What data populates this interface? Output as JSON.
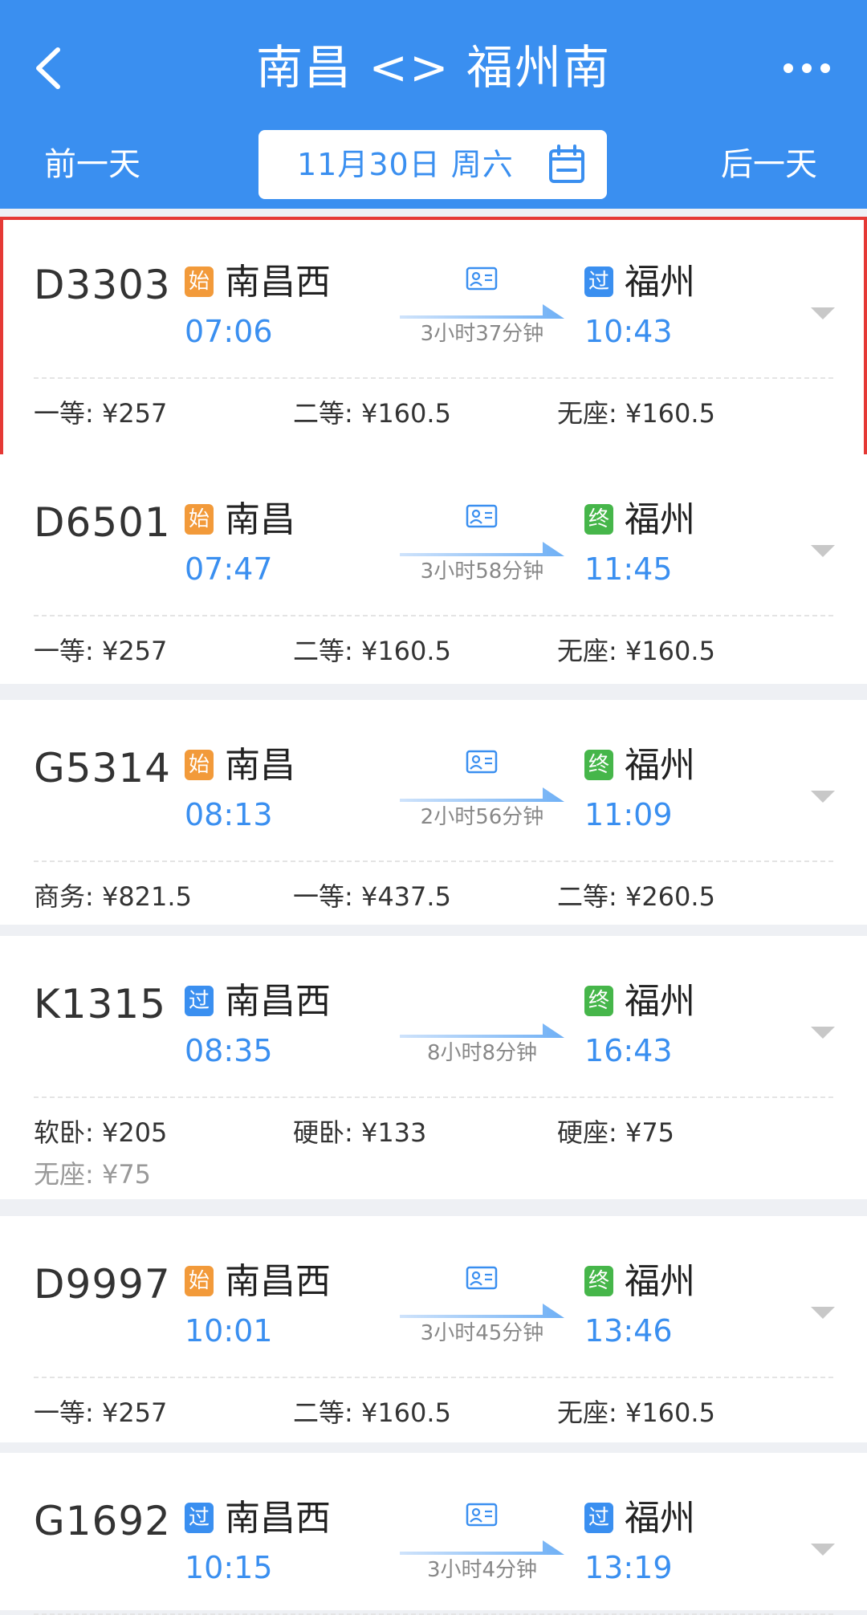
{
  "header": {
    "title": "南昌 <> 福州南",
    "prev_day": "前一天",
    "next_day": "后一天",
    "date": "11月30日 周六"
  },
  "colors": {
    "header_bg": "#3a8ff0",
    "accent": "#3a8ff0",
    "start_badge": "#f29a3a",
    "pass_badge": "#3a8ff0",
    "end_badge": "#46b64a",
    "highlight": "#e53935"
  },
  "icons": {
    "back": "chevron-left-icon",
    "more": "more-dots-icon",
    "calendar": "calendar-icon",
    "id_card": "id-card-icon",
    "expand": "chevron-down-icon"
  },
  "trains": [
    {
      "train_no": "D3303",
      "from_badge": "始",
      "from_badge_color": "orange",
      "from_station": "南昌西",
      "dep_time": "07:06",
      "duration": "3小时37分钟",
      "to_badge": "过",
      "to_badge_color": "blue",
      "to_station": "福州",
      "arr_time": "10:43",
      "show_id_icon": true,
      "selected": true,
      "prices": [
        "一等: ¥257",
        "二等:  ¥160.5",
        "无座:  ¥160.5"
      ]
    },
    {
      "train_no": "D6501",
      "from_badge": "始",
      "from_badge_color": "orange",
      "from_station": "南昌",
      "dep_time": "07:47",
      "duration": "3小时58分钟",
      "to_badge": "终",
      "to_badge_color": "green",
      "to_station": "福州",
      "arr_time": "11:45",
      "show_id_icon": true,
      "selected": false,
      "prices": [
        "一等: ¥257",
        "二等:  ¥160.5",
        "无座:  ¥160.5"
      ]
    },
    {
      "train_no": "G5314",
      "from_badge": "始",
      "from_badge_color": "orange",
      "from_station": "南昌",
      "dep_time": "08:13",
      "duration": "2小时56分钟",
      "to_badge": "终",
      "to_badge_color": "green",
      "to_station": "福州",
      "arr_time": "11:09",
      "show_id_icon": true,
      "selected": false,
      "prices": [
        "商务:  ¥821.5",
        "一等:  ¥437.5",
        "二等:  ¥260.5"
      ]
    },
    {
      "train_no": "K1315",
      "from_badge": "过",
      "from_badge_color": "blue",
      "from_station": "南昌西",
      "dep_time": "08:35",
      "duration": "8小时8分钟",
      "to_badge": "终",
      "to_badge_color": "green",
      "to_station": "福州",
      "arr_time": "16:43",
      "show_id_icon": false,
      "selected": false,
      "prices": [
        "软卧: ¥205",
        "硬卧: ¥133",
        "硬座: ¥75",
        "无座: ¥75"
      ]
    },
    {
      "train_no": "D9997",
      "from_badge": "始",
      "from_badge_color": "orange",
      "from_station": "南昌西",
      "dep_time": "10:01",
      "duration": "3小时45分钟",
      "to_badge": "终",
      "to_badge_color": "green",
      "to_station": "福州",
      "arr_time": "13:46",
      "show_id_icon": true,
      "selected": false,
      "prices": [
        "一等: ¥257",
        "二等:  ¥160.5",
        "无座:  ¥160.5"
      ]
    },
    {
      "train_no": "G1692",
      "from_badge": "过",
      "from_badge_color": "blue",
      "from_station": "南昌西",
      "dep_time": "10:15",
      "duration": "3小时4分钟",
      "to_badge": "过",
      "to_badge_color": "blue",
      "to_station": "福州",
      "arr_time": "13:19",
      "show_id_icon": true,
      "selected": false,
      "prices": []
    }
  ]
}
